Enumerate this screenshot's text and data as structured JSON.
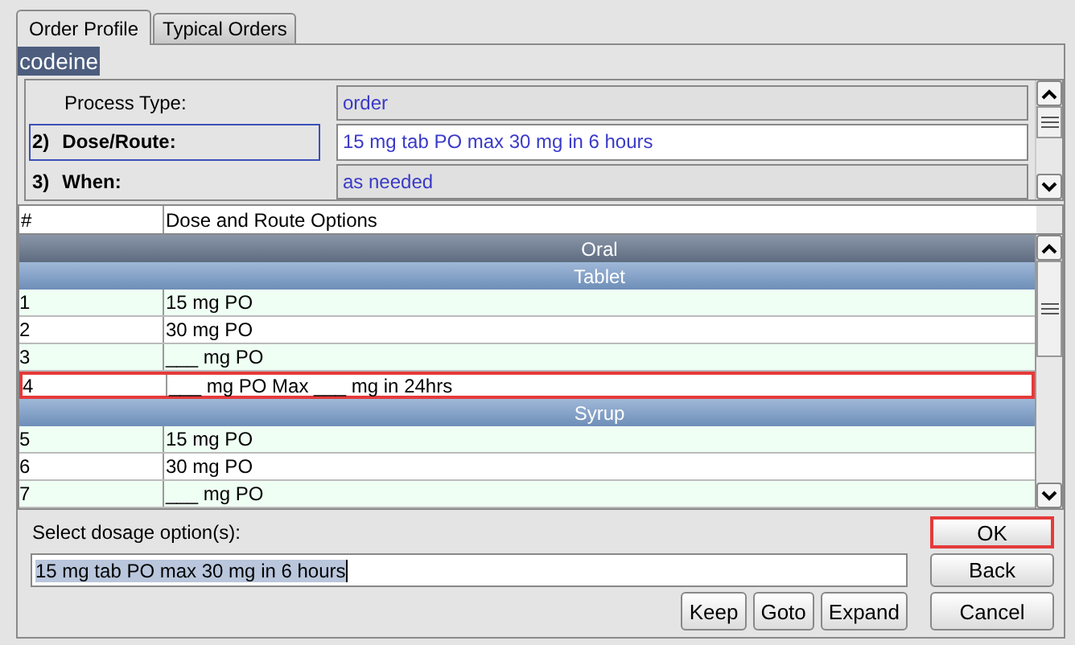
{
  "tabs": [
    {
      "label": "Order Profile",
      "selected": true
    },
    {
      "label": "Typical Orders",
      "selected": false
    }
  ],
  "drug_name": "codeine",
  "fields": [
    {
      "kind": "info",
      "label": "Process Type:",
      "value": "order",
      "selected": false
    },
    {
      "kind": "step",
      "number": "2)",
      "label": "Dose/Route:",
      "value": "15 mg tab PO max 30 mg in 6 hours",
      "selected": true
    },
    {
      "kind": "step",
      "number": "3)",
      "label": "When:",
      "value": "as needed",
      "selected": false
    }
  ],
  "table": {
    "columns": [
      "#",
      "Dose and Route Options"
    ],
    "rows": [
      {
        "kind": "category",
        "text": "Oral"
      },
      {
        "kind": "form",
        "text": "Tablet"
      },
      {
        "kind": "option",
        "number": "1",
        "text": "15 mg PO",
        "selected": false
      },
      {
        "kind": "option",
        "number": "2",
        "text": "30 mg PO",
        "selected": false
      },
      {
        "kind": "option",
        "number": "3",
        "text": "___ mg PO",
        "selected": false
      },
      {
        "kind": "option",
        "number": "4",
        "text": "___ mg PO Max ___ mg in 24hrs",
        "selected": true
      },
      {
        "kind": "form",
        "text": "Syrup"
      },
      {
        "kind": "option",
        "number": "5",
        "text": "15 mg PO",
        "selected": false
      },
      {
        "kind": "option",
        "number": "6",
        "text": "30 mg PO",
        "selected": false
      },
      {
        "kind": "option",
        "number": "7",
        "text": "___ mg PO",
        "selected": false
      }
    ]
  },
  "prompt": "Select dosage option(s):",
  "selection_value": "15 mg tab PO max 30 mg in 6 hours",
  "buttons": [
    {
      "label": "OK",
      "kind": "side",
      "focused": true
    },
    {
      "label": "Back",
      "kind": "side",
      "focused": false
    },
    {
      "label": "Keep",
      "kind": "small",
      "focused": false
    },
    {
      "label": "Goto",
      "kind": "small",
      "focused": false
    },
    {
      "label": "Expand",
      "kind": "small",
      "focused": false
    },
    {
      "label": "Cancel",
      "kind": "side",
      "focused": false
    }
  ]
}
